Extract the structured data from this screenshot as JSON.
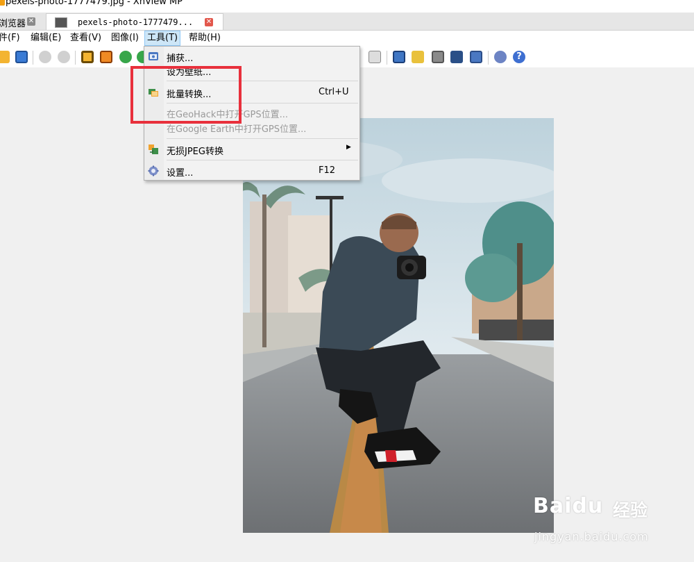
{
  "window": {
    "title": "pexels-photo-1777479.jpg - XnView MP"
  },
  "tabs": [
    {
      "label": "浏览器",
      "active": false
    },
    {
      "label": "pexels-photo-1777479...",
      "active": true
    }
  ],
  "menubar": {
    "items": [
      {
        "label": "文件(F)"
      },
      {
        "label": "编辑(E)"
      },
      {
        "label": "查看(V)"
      },
      {
        "label": "图像(I)"
      },
      {
        "label": "工具(T)"
      },
      {
        "label": "帮助(H)"
      }
    ]
  },
  "tools_menu": {
    "items": [
      {
        "label": "捕获...",
        "shortcut": "",
        "enabled": true,
        "icon": "capture-icon"
      },
      {
        "label": "设为壁纸...",
        "shortcut": "",
        "enabled": true,
        "icon": ""
      },
      {
        "label": "批量转换...",
        "shortcut": "Ctrl+U",
        "enabled": true,
        "icon": "batch-convert-icon"
      },
      {
        "label": "在GeoHack中打开GPS位置...",
        "shortcut": "",
        "enabled": false,
        "icon": ""
      },
      {
        "label": "在Google Earth中打开GPS位置...",
        "shortcut": "",
        "enabled": false,
        "icon": ""
      },
      {
        "label": "无损JPEG转换",
        "shortcut": "",
        "enabled": true,
        "icon": "lossless-jpeg-icon",
        "submenu": true
      },
      {
        "label": "设置...",
        "shortcut": "F12",
        "enabled": true,
        "icon": "settings-gear-icon"
      }
    ]
  },
  "watermark": {
    "brand": "Baidu",
    "cn": "经验",
    "url": "jingyan.baidu.com"
  },
  "colors": {
    "highlight": "#e8303c",
    "menu_open_bg": "#cde6f7",
    "tab_close": "#e2574c"
  }
}
